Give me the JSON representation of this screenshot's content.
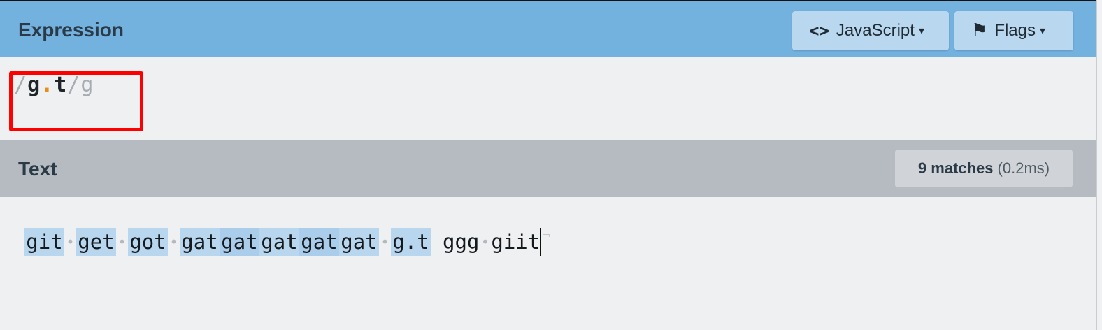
{
  "expression_header": {
    "title": "Expression",
    "language_button": {
      "icon": "code-icon",
      "icon_glyph": "<>",
      "label": "JavaScript",
      "caret": "▾"
    },
    "flags_button": {
      "icon": "flag-icon",
      "icon_glyph": "⚑",
      "label": "Flags",
      "caret": "▾"
    }
  },
  "expression": {
    "open_delimiter": "/",
    "pattern_start": "g",
    "pattern_dot": ".",
    "pattern_end": "t",
    "close_delimiter": "/",
    "flags": "g"
  },
  "text_header": {
    "title": "Text",
    "match_count": "9 matches",
    "match_time": "(0.2ms)"
  },
  "text": {
    "tokens": [
      {
        "text": "git",
        "highlighted": true
      },
      {
        "text": "get",
        "highlighted": true
      },
      {
        "text": "got",
        "highlighted": true
      },
      {
        "text": "gat",
        "highlighted": true
      },
      {
        "text": "gat",
        "highlighted": true
      },
      {
        "text": "gat",
        "highlighted": true
      },
      {
        "text": "gat",
        "highlighted": true
      },
      {
        "text": "gat",
        "highlighted": true
      },
      {
        "text": "g.t",
        "highlighted": true
      },
      {
        "text": "ggg",
        "highlighted": false
      },
      {
        "text": "giit",
        "highlighted": false
      }
    ],
    "space_marker": "•",
    "end_of_line_marker": "¬"
  },
  "colors": {
    "header_blue": "#73b1df",
    "header_gray": "#b5bbc0",
    "match_highlight": "#b8d7ef",
    "expression_dot": "#e88c1a",
    "annotation_box": "#ff0000"
  }
}
